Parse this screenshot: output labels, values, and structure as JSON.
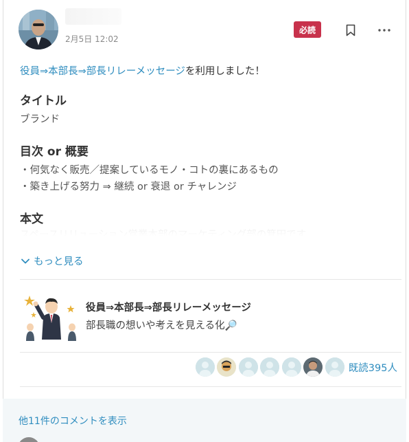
{
  "post": {
    "timestamp": "2月5日 12:02",
    "badge": "必読",
    "activity_link": "役員⇒本部長⇒部長リレーメッセージ",
    "activity_suffix": "を利用しました！",
    "sections": {
      "title_heading": "タイトル",
      "title_value": "ブランド",
      "toc_heading": "目次 or 概要",
      "toc_line1": "・何気なく販売／提案しているモノ・コトの裏にあるもの",
      "toc_line2": "・築き上げる努力 ⇒ 継続 or  衰退 or チャレンジ",
      "body_heading": "本文",
      "body_preview": "スペースリリューション営業本部のマーケティング部の箕田です"
    },
    "show_more": "もっと見る"
  },
  "attachment": {
    "title": "役員⇒本部長⇒部長リレーメッセージ",
    "description": "部長職の想いや考えを見える化🔎"
  },
  "readers": {
    "count_label": "既読395人"
  },
  "comments": {
    "show_label": "他11件のコメントを表示"
  },
  "colors": {
    "accent": "#2f8dbf",
    "badge": "#c8324c"
  },
  "icons": [
    "bookmark-icon",
    "more-icon",
    "chevron-down-icon"
  ]
}
